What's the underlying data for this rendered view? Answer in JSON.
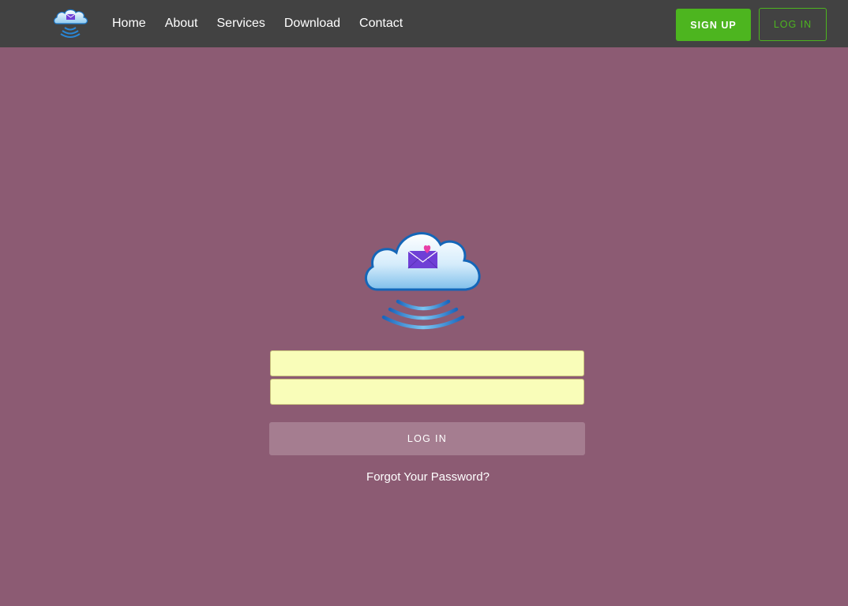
{
  "nav": {
    "logo_icon": "cloud-mail-icon",
    "links": [
      {
        "label": "Home"
      },
      {
        "label": "About"
      },
      {
        "label": "Services"
      },
      {
        "label": "Download"
      },
      {
        "label": "Contact"
      }
    ],
    "signup_label": "SIGN UP",
    "login_label": "LOG IN"
  },
  "login_form": {
    "logo_icon": "cloud-mail-icon",
    "username_value": "",
    "password_value": "",
    "submit_label": "LOG IN",
    "forgot_label": "Forgot Your Password?"
  },
  "colors": {
    "page_background": "#8c5b73",
    "navbar_background": "#424242",
    "accent_green": "#4db51f",
    "input_background": "#f9fdb9",
    "login_button_background": "#a57d90"
  }
}
